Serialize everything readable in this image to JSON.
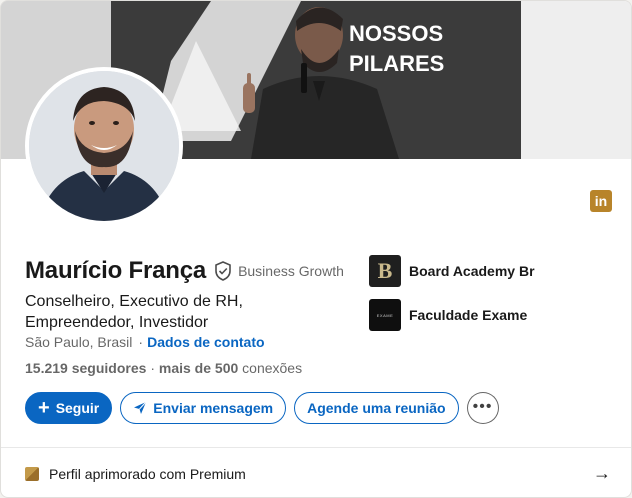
{
  "banner": {
    "text_line1": "NOSSOS",
    "text_line2": "PILARES"
  },
  "profile": {
    "name": "Maurício França",
    "badge_text": "Business Growth",
    "headline": "Conselheiro, Executivo de RH, Empreendedor, Investidor",
    "location": "São Paulo, Brasil",
    "contact_link": "Dados de contato",
    "followers_count": "15.219",
    "followers_label": "seguidores",
    "connections_prefix": "mais de 500",
    "connections_label": "conexões"
  },
  "brand_icon": {
    "label": "in",
    "color": "#b8842a"
  },
  "organizations": [
    {
      "name": "Board Academy Br",
      "logo_text": "B"
    },
    {
      "name": "Faculdade Exame",
      "logo_text": "EXAME"
    }
  ],
  "actions": {
    "follow_label": "Seguir",
    "message_label": "Enviar mensagem",
    "schedule_label": "Agende uma reunião",
    "more_label": "•••"
  },
  "premium": {
    "label": "Perfil aprimorado com Premium",
    "arrow": "→"
  },
  "colors": {
    "primary": "#0a66c2",
    "premium_gold": "#b8842a"
  }
}
